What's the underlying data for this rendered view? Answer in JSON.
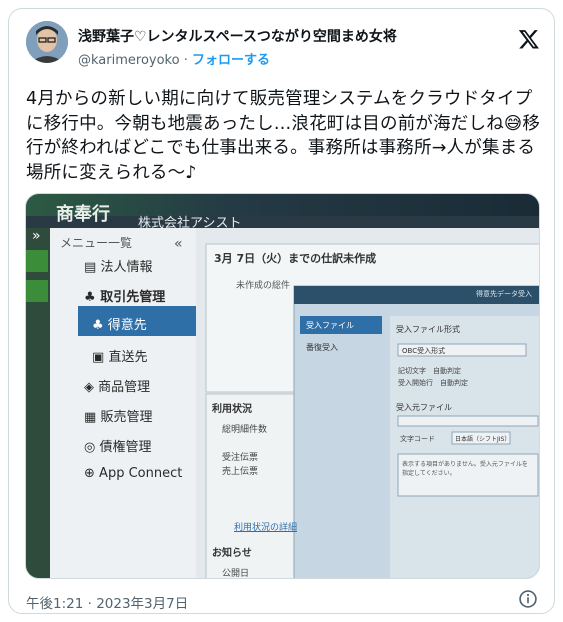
{
  "author": {
    "display_name": "浅野葉子♡レンタルスペースつながり空間まめ女将",
    "handle": "@karimeroyoko",
    "separator": "·",
    "follow_label": "フォローする"
  },
  "tweet": {
    "text": "4月からの新しい期に向けて販売管理システムをクラウドタイプに移行中。今朝も地震あったし…浪花町は目の前が海だしね😅移行が終わればどこでも仕事出来る。事務所は事務所→人が集まる場所に変えられる〜♪",
    "timestamp": "午後1:21 · 2023年3月7日"
  },
  "photo": {
    "brand": "商奉行",
    "company": "株式会社アシスト",
    "menu_title": "メニュー一覧",
    "menu_collapse": "«",
    "menu_expand": "»",
    "menu_items": [
      {
        "label": "法人情報",
        "icon": "building-icon"
      },
      {
        "label": "取引先管理",
        "icon": "people-icon"
      },
      {
        "label": "得意先",
        "icon": "people-icon"
      },
      {
        "label": "直送先",
        "icon": "truck-icon"
      },
      {
        "label": "商品管理",
        "icon": "box-icon"
      },
      {
        "label": "販売管理",
        "icon": "register-icon"
      },
      {
        "label": "債権管理",
        "icon": "yen-bag-icon"
      },
      {
        "label": "App Connect",
        "icon": "globe-icon"
      }
    ],
    "panel_title": "3月 7日（火）までの仕訳未作成",
    "panel_sub": "未作成の総件",
    "usage_title": "利用状況",
    "usage_items": [
      "総明細件数",
      "受注伝票",
      "売上伝票"
    ],
    "usage_link": "利用状況の詳細",
    "notice_title": "お知らせ",
    "notice_item": "公開日",
    "dialog": {
      "header_right": "得意先データ受入",
      "side_items": [
        "受入ファイル",
        "番復受入"
      ],
      "format_label": "受入ファイル形式",
      "format_value": "OBC受入形式",
      "rows": [
        [
          "記切文字",
          "自動判定"
        ],
        [
          "受入開始行",
          "自動判定"
        ]
      ],
      "file_label": "受入元ファイル",
      "charset_label": "文字コード",
      "charset_value": "日本語（シフトJIS）",
      "message": "表示する項目がありません。受入元ファイルを指定してください。"
    }
  }
}
